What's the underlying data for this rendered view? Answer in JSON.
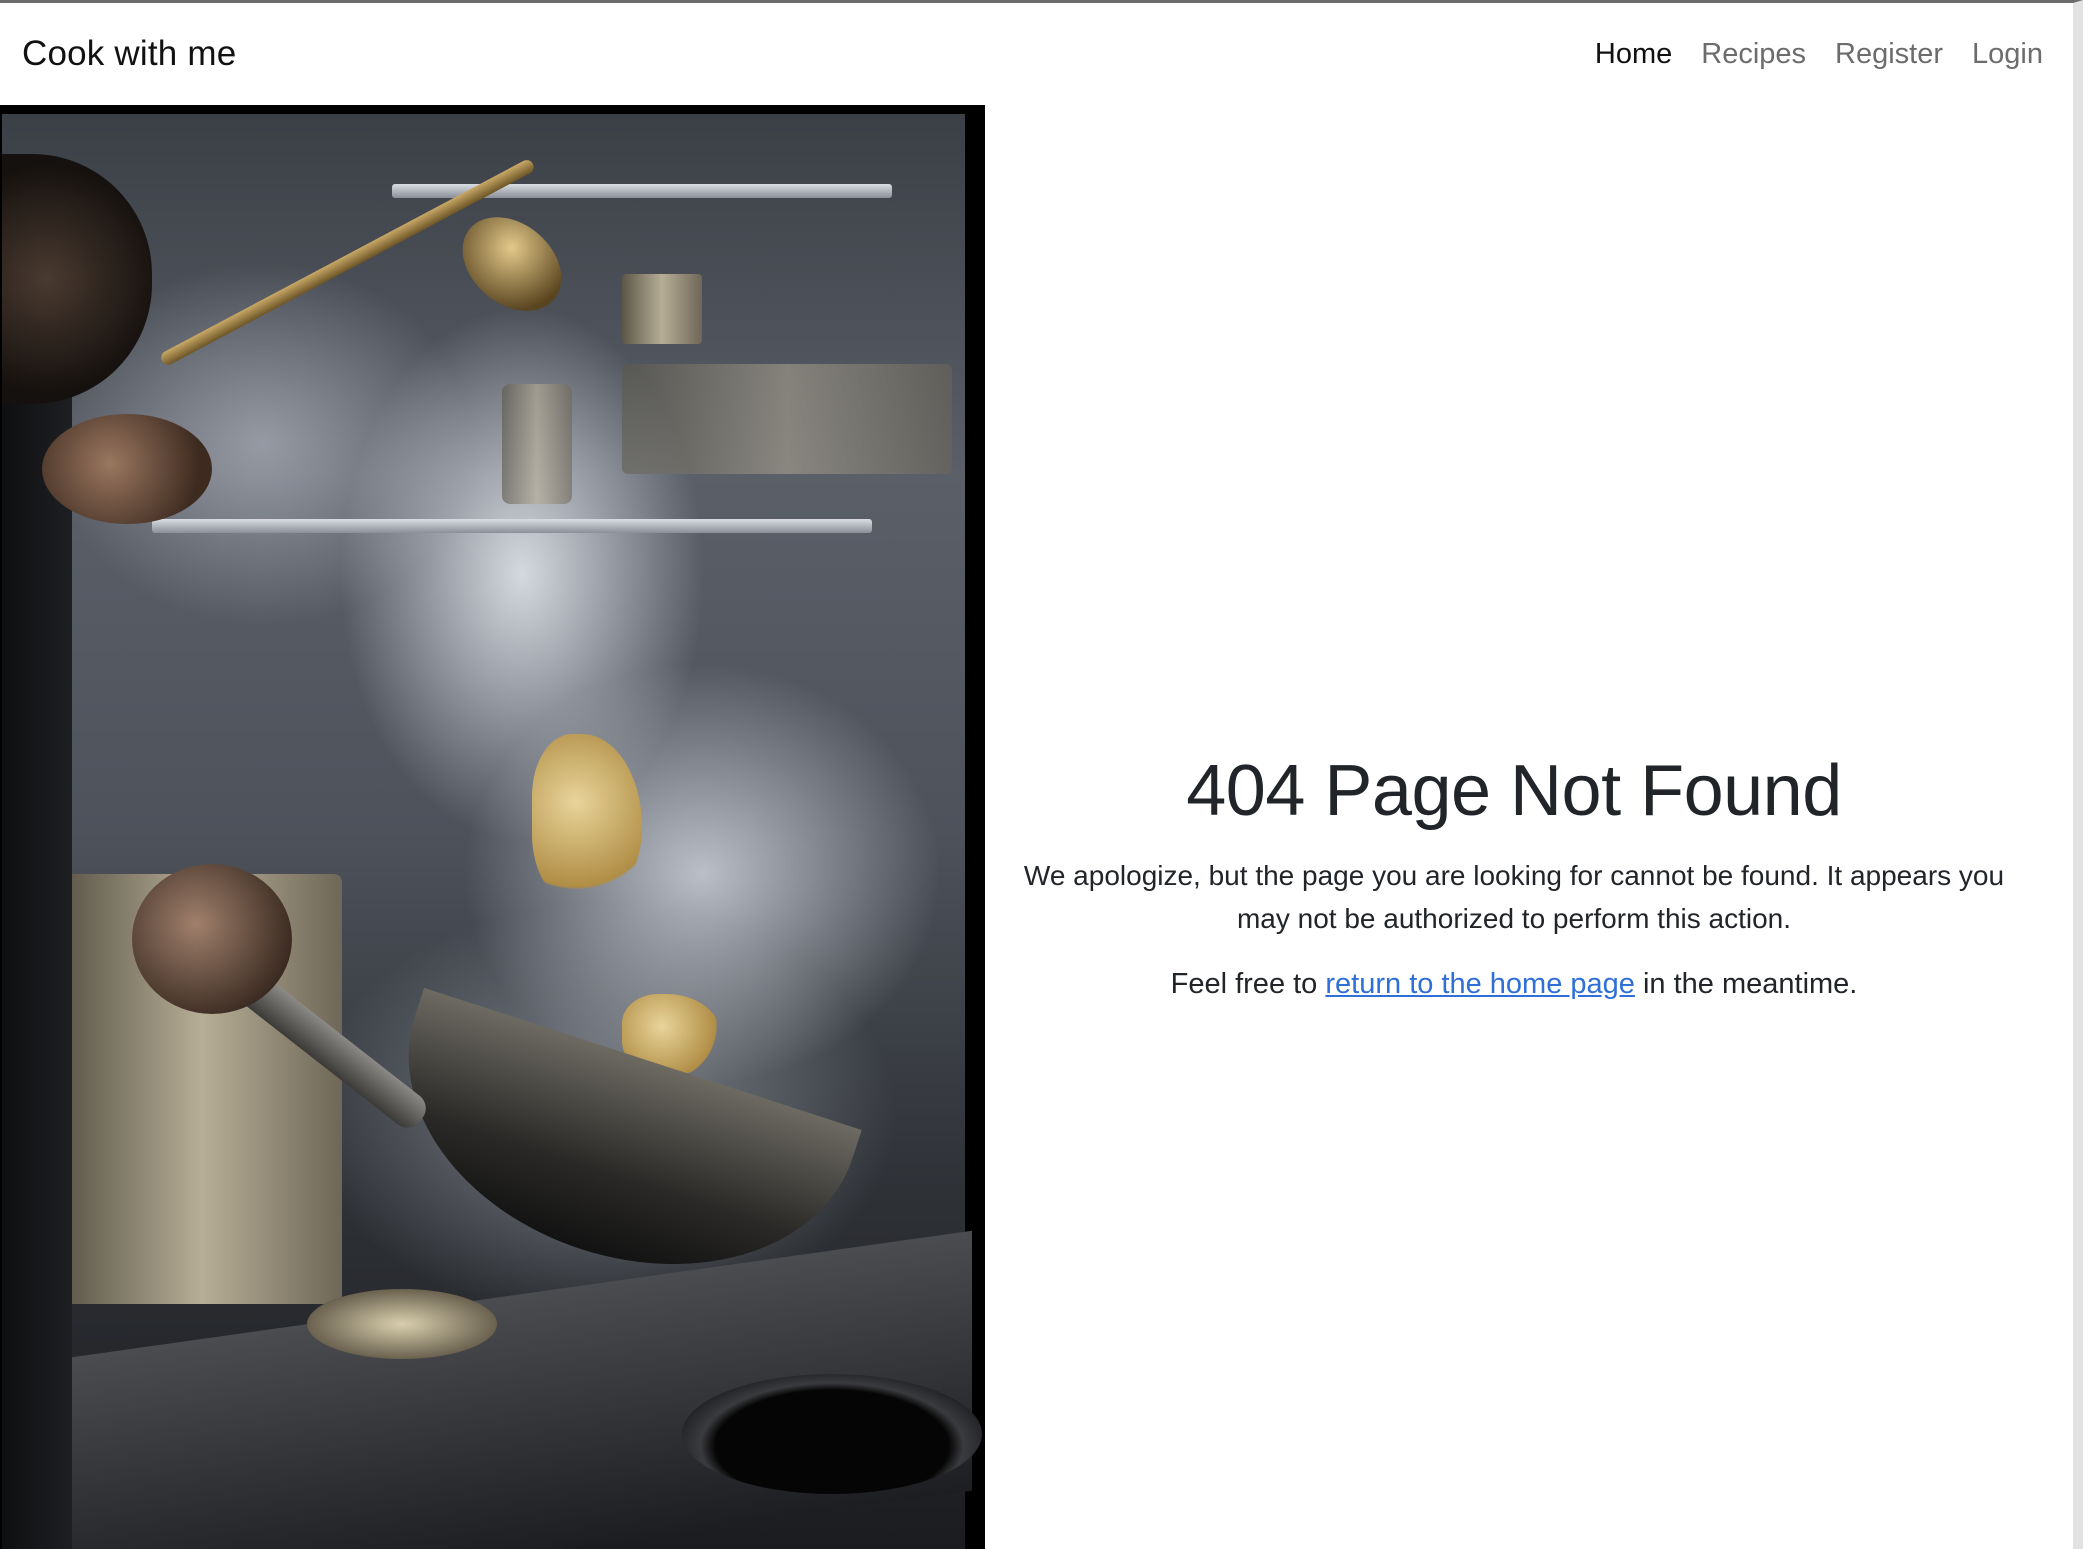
{
  "navbar": {
    "brand": "Cook with me",
    "links": [
      {
        "label": "Home",
        "active": true
      },
      {
        "label": "Recipes",
        "active": false
      },
      {
        "label": "Register",
        "active": false
      },
      {
        "label": "Login",
        "active": false
      }
    ]
  },
  "hero_image": {
    "description_icon": "kitchen-wok-photo"
  },
  "error": {
    "title": "404 Page Not Found",
    "message": "We apologize, but the page you are looking for cannot be found. It appears you may not be authorized to perform this action.",
    "feel_prefix": "Feel free to ",
    "link_text": "return to the home page",
    "feel_suffix": " in the meantime."
  },
  "colors": {
    "link": "#2f6fd8",
    "text": "#212529",
    "nav_inactive": "#6c6c6c"
  }
}
